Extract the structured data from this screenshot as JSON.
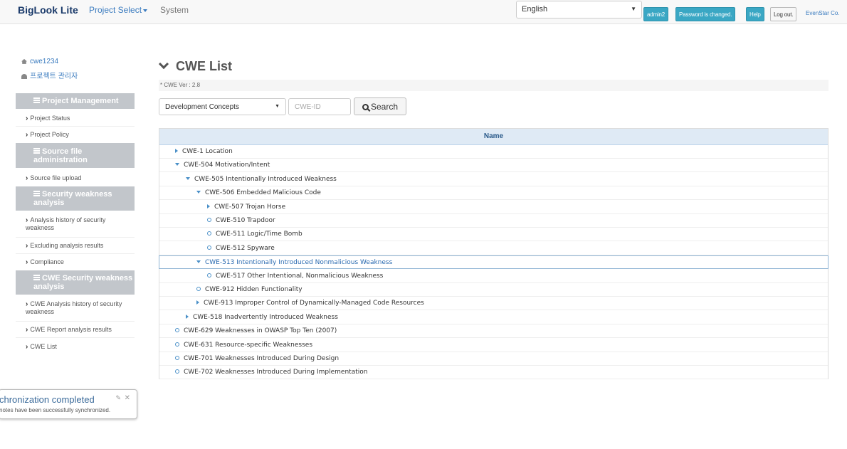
{
  "navbar": {
    "brand": "BigLook Lite",
    "project_select": "Project Select",
    "system": "System",
    "language": "English",
    "admin": "admin2",
    "password_notice": "Password is changed.",
    "help": "Help",
    "logout": "Log out.",
    "company": "EvenStar Co."
  },
  "sidebar": {
    "user_id": "cwe1234",
    "user_role": "프로젝트 관리자",
    "sections": [
      {
        "title": "Project Management",
        "items": [
          "Project Status",
          "Project Policy"
        ]
      },
      {
        "title": "Source file administration",
        "items": [
          "Source file upload"
        ]
      },
      {
        "title": "Security weakness analysis",
        "items": [
          "Analysis history of security weakness",
          "Excluding analysis results",
          "Compliance"
        ]
      },
      {
        "title": "CWE Security weakness analysis",
        "items": [
          "CWE Analysis history of security weakness",
          "CWE Report analysis results",
          "CWE List"
        ]
      }
    ]
  },
  "main": {
    "title": "CWE List",
    "version": "* CWE Ver : 2.8",
    "concept_select": "Development Concepts",
    "cwe_id_placeholder": "CWE-ID",
    "search_label": "Search",
    "column_name": "Name",
    "rows": [
      {
        "label": "CWE-1 Location",
        "level": 0,
        "state": "collapsed"
      },
      {
        "label": "CWE-504 Motivation/Intent",
        "level": 0,
        "state": "expanded"
      },
      {
        "label": "CWE-505 Intentionally Introduced Weakness",
        "level": 1,
        "state": "expanded"
      },
      {
        "label": "CWE-506 Embedded Malicious Code",
        "level": 2,
        "state": "expanded"
      },
      {
        "label": "CWE-507 Trojan Horse",
        "level": 3,
        "state": "collapsed"
      },
      {
        "label": "CWE-510 Trapdoor",
        "level": 3,
        "state": "leaf"
      },
      {
        "label": "CWE-511 Logic/Time Bomb",
        "level": 3,
        "state": "leaf"
      },
      {
        "label": "CWE-512 Spyware",
        "level": 3,
        "state": "leaf"
      },
      {
        "label": "CWE-513 Intentionally Introduced Nonmalicious Weakness",
        "level": 2,
        "state": "expanded",
        "selected": true
      },
      {
        "label": "CWE-517 Other Intentional, Nonmalicious Weakness",
        "level": 3,
        "state": "leaf"
      },
      {
        "label": "CWE-912 Hidden Functionality",
        "level": 2,
        "state": "leaf"
      },
      {
        "label": "CWE-913 Improper Control of Dynamically-Managed Code Resources",
        "level": 2,
        "state": "collapsed"
      },
      {
        "label": "CWE-518 Inadvertently Introduced Weakness",
        "level": 1,
        "state": "collapsed"
      },
      {
        "label": "CWE-629 Weaknesses in OWASP Top Ten (2007)",
        "level": 0,
        "state": "leaf"
      },
      {
        "label": "CWE-631 Resource-specific Weaknesses",
        "level": 0,
        "state": "leaf"
      },
      {
        "label": "CWE-701 Weaknesses Introduced During Design",
        "level": 0,
        "state": "leaf"
      },
      {
        "label": "CWE-702 Weaknesses Introduced During Implementation",
        "level": 0,
        "state": "leaf"
      }
    ]
  },
  "toast": {
    "title": "chronization completed",
    "message": "notes have been successfully synchronized."
  },
  "colors": {
    "accent": "#3a7bbf",
    "info_button": "#3aa7c4",
    "sidebar_header": "#c2c6cb",
    "table_header": "#dfeaf5"
  }
}
